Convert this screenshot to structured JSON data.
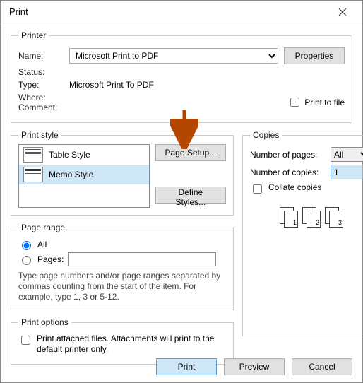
{
  "title": "Print",
  "printer": {
    "legend": "Printer",
    "name_label": "Name:",
    "name_value": "Microsoft Print to PDF",
    "properties_btn": "Properties",
    "status_label": "Status:",
    "status_value": "",
    "type_label": "Type:",
    "type_value": "Microsoft Print To PDF",
    "where_label": "Where:",
    "where_value": "",
    "comment_label": "Comment:",
    "comment_value": "",
    "print_to_file": "Print to file"
  },
  "print_style": {
    "legend": "Print style",
    "items": [
      "Table Style",
      "Memo Style"
    ],
    "page_setup_btn": "Page Setup...",
    "define_styles_btn": "Define Styles..."
  },
  "copies": {
    "legend": "Copies",
    "pages_label": "Number of pages:",
    "pages_value": "All",
    "copies_label": "Number of copies:",
    "copies_value": "1",
    "collate_label": "Collate copies"
  },
  "page_range": {
    "legend": "Page range",
    "all": "All",
    "pages": "Pages:",
    "help": "Type page numbers and/or page ranges separated by commas counting from the start of the item.  For example, type 1, 3 or 5-12."
  },
  "print_options": {
    "legend": "Print options",
    "attached": "Print attached files.  Attachments will print to the default printer only."
  },
  "footer": {
    "print": "Print",
    "preview": "Preview",
    "cancel": "Cancel"
  }
}
